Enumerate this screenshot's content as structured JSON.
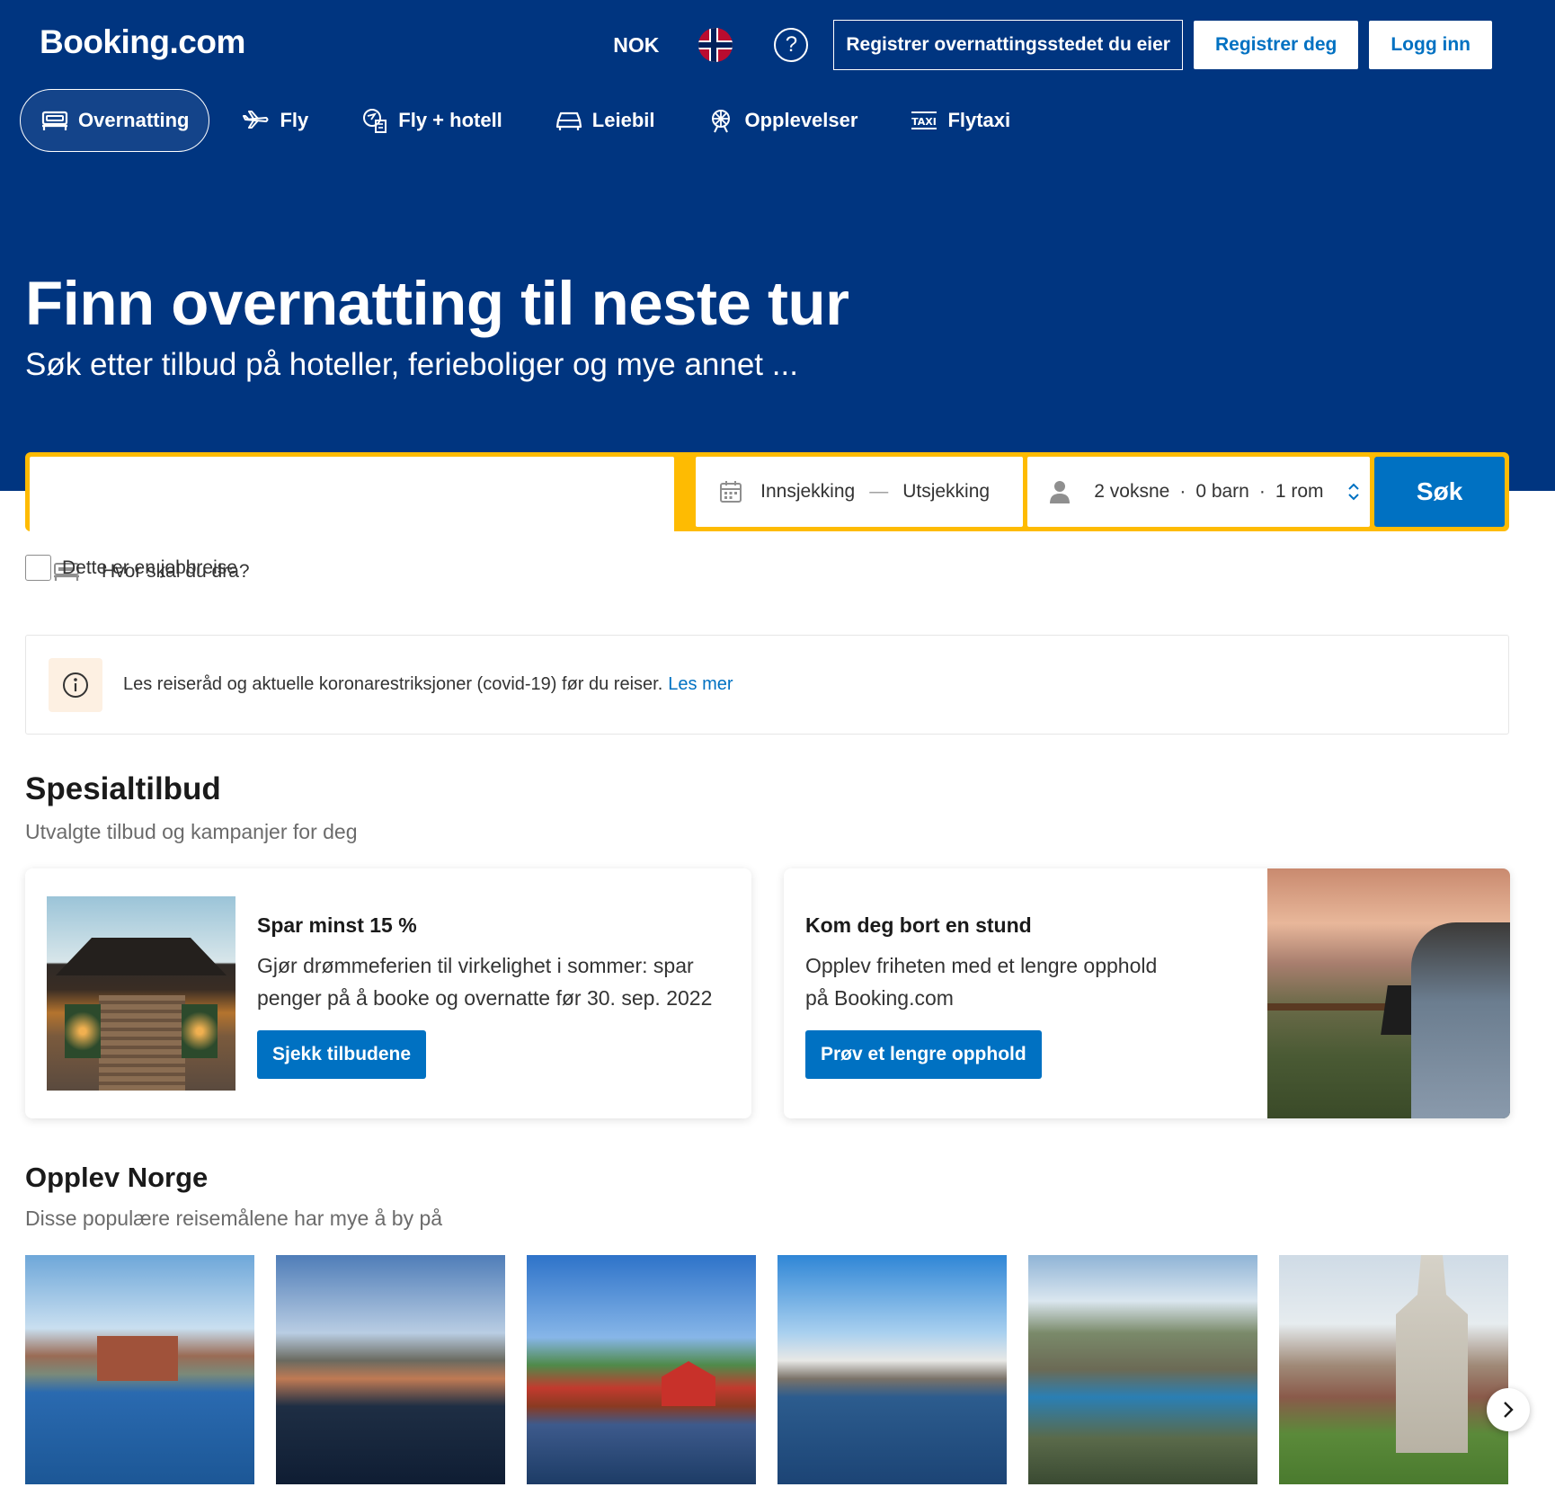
{
  "header": {
    "logo": "Booking.com",
    "currency": "NOK",
    "language_flag": "norway-flag",
    "help_icon": "question-circle-icon",
    "register_property": "Registrer overnattingsstedet du eier",
    "register": "Registrer deg",
    "login": "Logg inn"
  },
  "nav": {
    "items": [
      {
        "label": "Overnatting",
        "icon": "bed-icon",
        "active": true
      },
      {
        "label": "Fly",
        "icon": "plane-icon"
      },
      {
        "label": "Fly + hotell",
        "icon": "flight-hotel-icon"
      },
      {
        "label": "Leiebil",
        "icon": "car-icon"
      },
      {
        "label": "Opplevelser",
        "icon": "attractions-icon"
      },
      {
        "label": "Flytaxi",
        "icon": "taxi-icon"
      }
    ]
  },
  "hero": {
    "title": "Finn overnatting til neste tur",
    "subtitle": "Søk etter tilbud på hoteller, ferieboliger og mye annet ..."
  },
  "search": {
    "destination_placeholder": "Hvor skal du dra?",
    "checkin": "Innsjekking",
    "date_separator": "—",
    "checkout": "Utsjekking",
    "adults": "2 voksne",
    "children": "0 barn",
    "rooms": "1 rom",
    "dot": "·",
    "button": "Søk"
  },
  "business_trip": {
    "label": "Dette er en jobbreise",
    "checked": false
  },
  "notice": {
    "text": "Les reiseråd og aktuelle koronarestriksjoner (covid-19) før du reiser.",
    "link": "Les mer"
  },
  "offers": {
    "title": "Spesialtilbud",
    "subtitle": "Utvalgte tilbud og kampanjer for deg",
    "cards": [
      {
        "title": "Spar minst 15 %",
        "text_line1": "Gjør drømmeferien til virkelighet i sommer: spar",
        "text_line2": "penger på å booke og overnatte før 30. sep. 2022",
        "button": "Sjekk tilbudene"
      },
      {
        "title": "Kom deg bort en stund",
        "text_line1": "Opplev friheten med et lengre opphold",
        "text_line2": "på Booking.com",
        "button": "Prøv et lengre opphold"
      }
    ]
  },
  "explore": {
    "title": "Opplev Norge",
    "subtitle": "Disse populære reisemålene har mye å by på"
  },
  "colors": {
    "brand_blue": "#003580",
    "action_blue": "#0071c2",
    "search_yellow": "#febb02"
  }
}
